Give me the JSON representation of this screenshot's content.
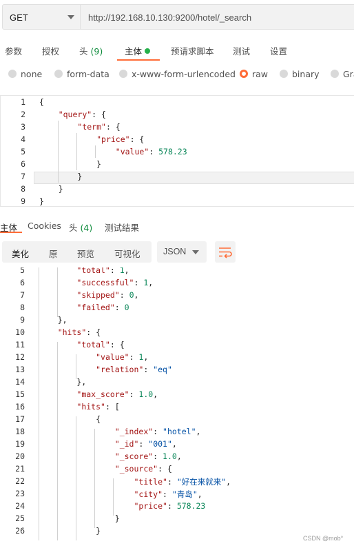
{
  "request": {
    "method": "GET",
    "url": "http://192.168.10.130:9200/hotel/_search"
  },
  "request_tabs": [
    {
      "label": "参数",
      "count": "",
      "active": false
    },
    {
      "label": "授权",
      "count": "",
      "active": false
    },
    {
      "label": "头",
      "count": "(9)",
      "active": false
    },
    {
      "label": "主体",
      "count": "",
      "active": true
    },
    {
      "label": "预请求脚本",
      "count": "",
      "active": false
    },
    {
      "label": "测试",
      "count": "",
      "active": false
    },
    {
      "label": "设置",
      "count": "",
      "active": false
    }
  ],
  "body_types": [
    {
      "label": "none",
      "selected": false
    },
    {
      "label": "form-data",
      "selected": false
    },
    {
      "label": "x-www-form-urlencoded",
      "selected": false
    },
    {
      "label": "raw",
      "selected": true
    },
    {
      "label": "binary",
      "selected": false
    },
    {
      "label": "Gra",
      "selected": false
    }
  ],
  "request_body_lines": [
    {
      "n": "1",
      "text": "{"
    },
    {
      "n": "2",
      "text": "    \"query\": {"
    },
    {
      "n": "3",
      "text": "        \"term\": {"
    },
    {
      "n": "4",
      "text": "            \"price\": {"
    },
    {
      "n": "5",
      "text": "                \"value\": 578.23"
    },
    {
      "n": "6",
      "text": "            }"
    },
    {
      "n": "7",
      "text": "        }"
    },
    {
      "n": "8",
      "text": "    }"
    },
    {
      "n": "9",
      "text": "}"
    }
  ],
  "response_tabs": [
    {
      "label": "主体",
      "count": "",
      "active": true
    },
    {
      "label": "Cookies",
      "count": "",
      "active": false
    },
    {
      "label": "头",
      "count": "(4)",
      "active": false
    },
    {
      "label": "测试结果",
      "count": "",
      "active": false
    }
  ],
  "view_modes": [
    {
      "label": "美化",
      "active": true
    },
    {
      "label": "原",
      "active": false
    },
    {
      "label": "预览",
      "active": false
    },
    {
      "label": "可视化",
      "active": false
    }
  ],
  "format_select": "JSON",
  "wrap_icon": "wrap-lines-icon",
  "response_lines": [
    {
      "n": "5",
      "text": "        \"total\": 1,"
    },
    {
      "n": "6",
      "text": "        \"successful\": 1,"
    },
    {
      "n": "7",
      "text": "        \"skipped\": 0,"
    },
    {
      "n": "8",
      "text": "        \"failed\": 0"
    },
    {
      "n": "9",
      "text": "    },"
    },
    {
      "n": "10",
      "text": "    \"hits\": {"
    },
    {
      "n": "11",
      "text": "        \"total\": {"
    },
    {
      "n": "12",
      "text": "            \"value\": 1,"
    },
    {
      "n": "13",
      "text": "            \"relation\": \"eq\""
    },
    {
      "n": "14",
      "text": "        },"
    },
    {
      "n": "15",
      "text": "        \"max_score\": 1.0,"
    },
    {
      "n": "16",
      "text": "        \"hits\": ["
    },
    {
      "n": "17",
      "text": "            {"
    },
    {
      "n": "18",
      "text": "                \"_index\": \"hotel\","
    },
    {
      "n": "19",
      "text": "                \"_id\": \"001\","
    },
    {
      "n": "20",
      "text": "                \"_score\": 1.0,"
    },
    {
      "n": "21",
      "text": "                \"_source\": {"
    },
    {
      "n": "22",
      "text": "                    \"title\": \"好在来就来\","
    },
    {
      "n": "23",
      "text": "                    \"city\": \"青岛\","
    },
    {
      "n": "24",
      "text": "                    \"price\": 578.23"
    },
    {
      "n": "25",
      "text": "                }"
    },
    {
      "n": "26",
      "text": "            }"
    }
  ],
  "watermark": "CSDN @mob°",
  "colors": {
    "accent": "#ff6c37",
    "active_dot": "#26b14b",
    "count": "#0c8a3a",
    "json_key": "#a31515",
    "json_string": "#0451a5",
    "json_number": "#098658"
  }
}
